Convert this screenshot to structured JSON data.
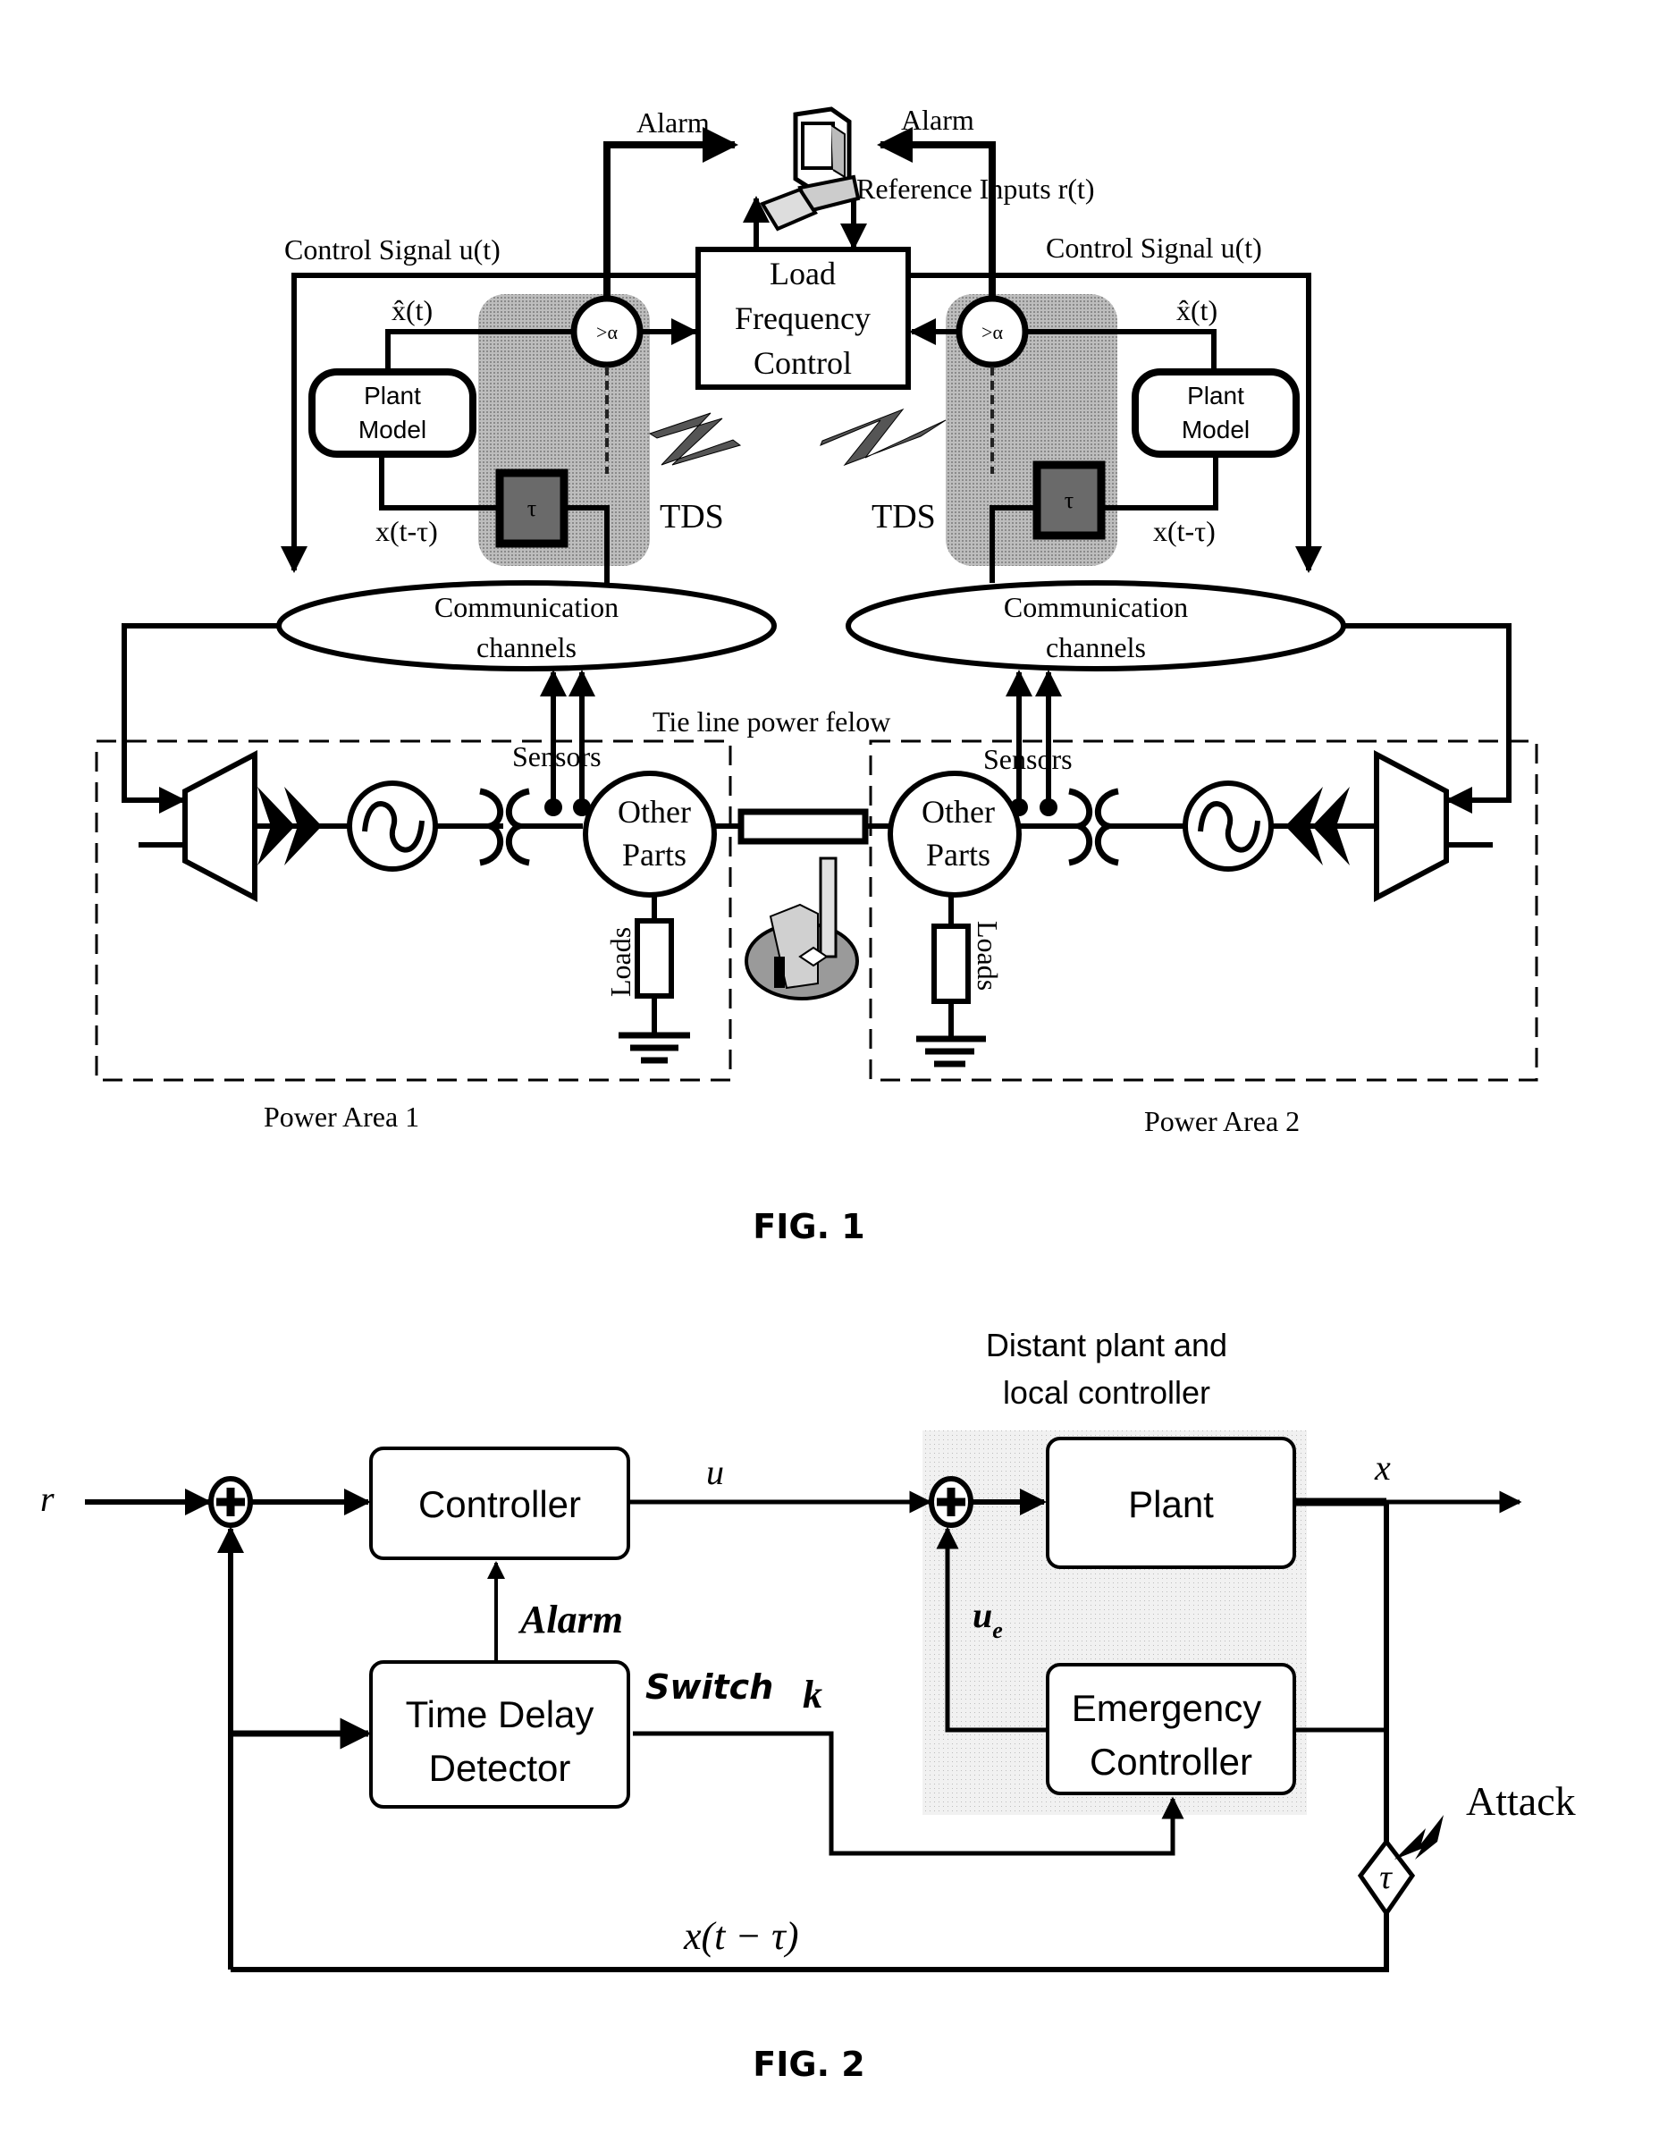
{
  "fig1": {
    "caption": "FIG. 1",
    "alarm_left": "Alarm",
    "alarm_right": "Alarm",
    "reference_inputs": "Reference Inputs r(t)",
    "control_signal_left": "Control Signal u(t)",
    "control_signal_right": "Control Signal u(t)",
    "lfc_box": [
      "Load",
      "Frequency",
      "Control"
    ],
    "comparator_label": ">α",
    "xhat_left": "x̂(t)",
    "xhat_right": "x̂(t)",
    "plant_model_left": [
      "Plant",
      "Model"
    ],
    "plant_model_right": [
      "Plant",
      "Model"
    ],
    "delay_left": "x(t-τ)",
    "delay_right": "x(t-τ)",
    "tau_label": "τ",
    "tds_left": "TDS",
    "tds_right": "TDS",
    "comm_left": [
      "Communication",
      "channels"
    ],
    "comm_right": [
      "Communication",
      "channels"
    ],
    "tie_line": "Tie line power felow",
    "sensors_left": "Sensors",
    "sensors_right": "Sensors",
    "other_parts_left": [
      "Other",
      "Parts"
    ],
    "other_parts_right": [
      "Other",
      "Parts"
    ],
    "loads_left": "Loads",
    "loads_right": "Loads",
    "area1": "Power Area 1",
    "area2": "Power Area 2"
  },
  "fig2": {
    "caption": "FIG. 2",
    "r": "r",
    "u": "u",
    "x": "x",
    "ue_main": "u",
    "ue_sub": "e",
    "controller": "Controller",
    "plant": "Plant",
    "emergency": [
      "Emergency",
      "Controller"
    ],
    "tdd": [
      "Time Delay",
      "Detector"
    ],
    "alarm": "Alarm",
    "switch": "Switch",
    "k": "k",
    "distant": [
      "Distant plant and",
      "local controller"
    ],
    "attack": "Attack",
    "delayed": "x(t − τ)",
    "tau": "τ"
  },
  "colors": {
    "line": "#000000",
    "tds_shade": "#a8a8a8",
    "tau_box": "#555555",
    "distant_shade": "#e6e6e6"
  }
}
